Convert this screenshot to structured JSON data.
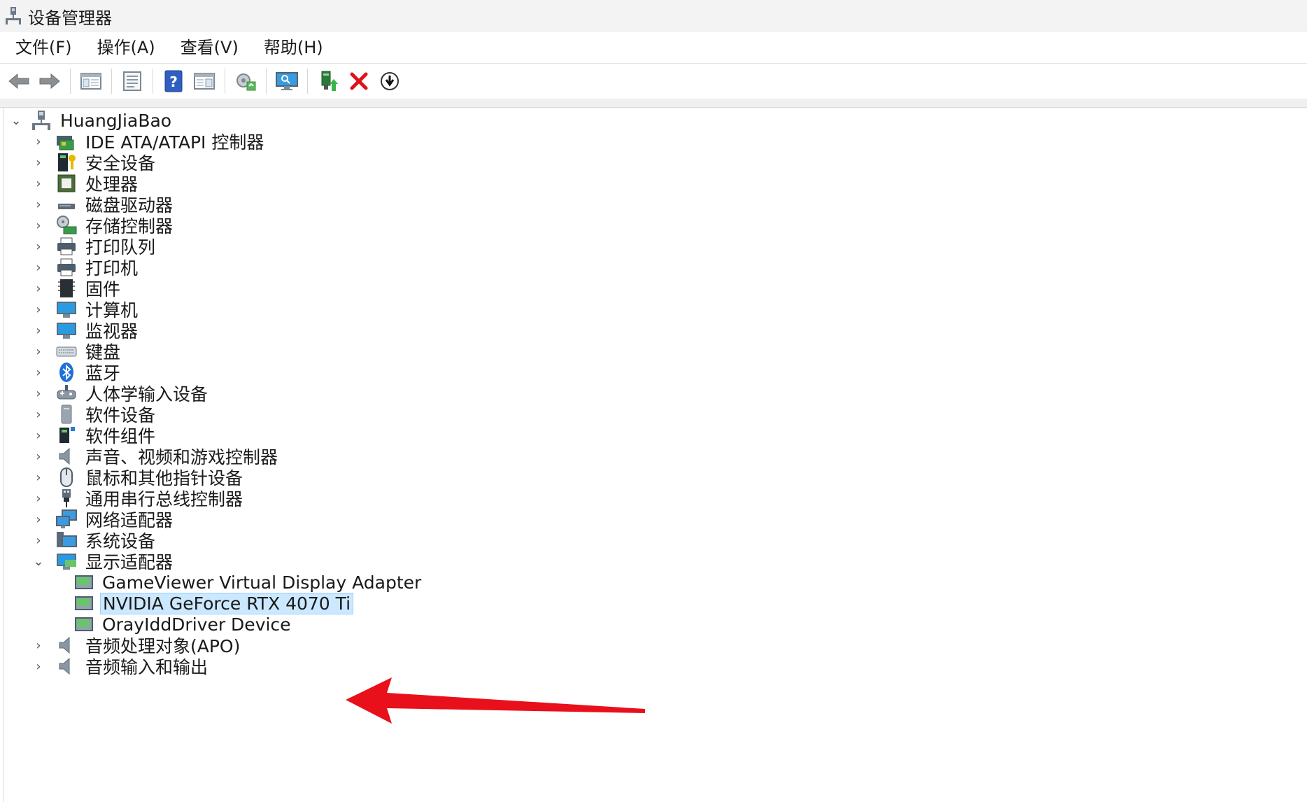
{
  "window": {
    "title": "设备管理器"
  },
  "menu": [
    "文件(F)",
    "操作(A)",
    "查看(V)",
    "帮助(H)"
  ],
  "toolbar": {
    "buttons": [
      "back-icon",
      "forward-icon",
      "show-hide-tree-icon",
      "properties-icon",
      "help-icon",
      "view-icon",
      "scan-hardware-icon",
      "monitor-icon",
      "update-driver-icon",
      "uninstall-icon",
      "disable-icon"
    ]
  },
  "tree": {
    "root": "HuangJiaBao",
    "categories": [
      "IDE ATA/ATAPI 控制器",
      "安全设备",
      "处理器",
      "磁盘驱动器",
      "存储控制器",
      "打印队列",
      "打印机",
      "固件",
      "计算机",
      "监视器",
      "键盘",
      "蓝牙",
      "人体学输入设备",
      "软件设备",
      "软件组件",
      "声音、视频和游戏控制器",
      "鼠标和其他指针设备",
      "通用串行总线控制器",
      "网络适配器",
      "系统设备",
      "显示适配器"
    ],
    "display_children": [
      "GameViewer Virtual Display Adapter",
      "NVIDIA GeForce RTX 4070 Ti",
      "OrayIddDriver Device"
    ],
    "after_categories": [
      "音频处理对象(APO)",
      "音频输入和输出"
    ]
  },
  "colors": {
    "selection": "#cce8ff",
    "annotation_arrow": "#e8101a",
    "uninstall_x": "#e0121a"
  }
}
